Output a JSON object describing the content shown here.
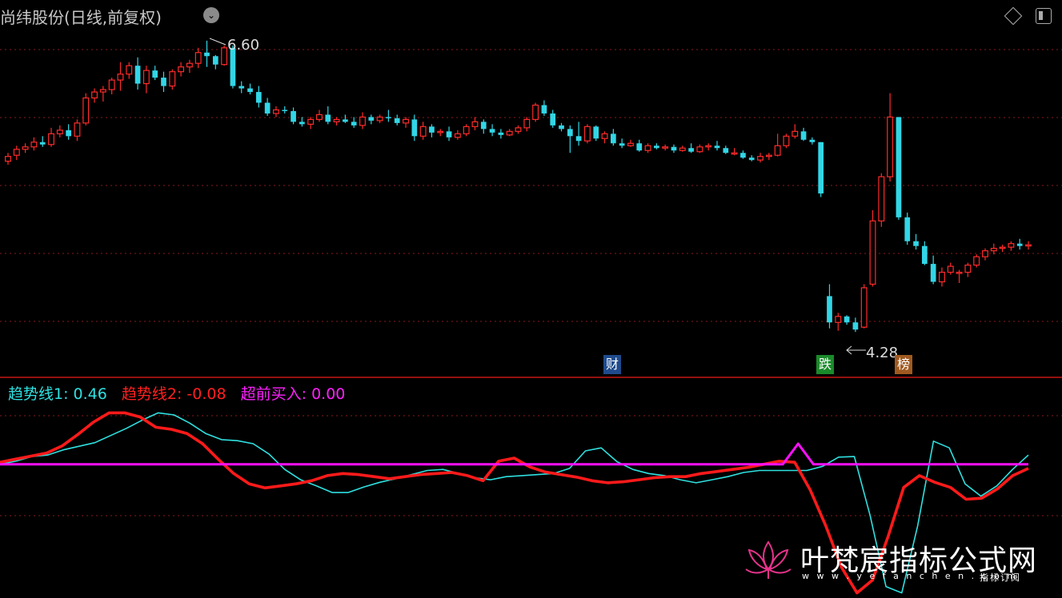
{
  "header": {
    "title": "尚纬股份(日线,前复权)",
    "dropdown_icon": "chevron-down-icon",
    "buttons": [
      "diamond-icon",
      "window-toggle-icon"
    ]
  },
  "colors": {
    "up": "#ff2b2b",
    "down": "#32d6e6",
    "line1": "#2fe0e0",
    "line2": "#ff1a1a",
    "line3": "#ff10ff",
    "grid": "#8a1a1a",
    "separator": "#c81414"
  },
  "annotations": {
    "high_label": "6.60",
    "low_label": "4.28"
  },
  "badges": {
    "cai": "财",
    "die": "跌",
    "bang": "榜"
  },
  "indicator": {
    "line1_label": "趋势线1: 0.46",
    "line2_label": "趋势线2: -0.08",
    "line3_label": "超前买入: 0.00"
  },
  "watermark": {
    "title": "叶梵宸指标公式网",
    "url": "w w w . y e f a n c h e n . c o m",
    "slogan": "指标订阅"
  },
  "chart_data": [
    {
      "type": "candlestick",
      "title": "尚纬股份(日线,前复权)",
      "ylim": [
        4.0,
        7.0
      ],
      "series": [
        {
          "name": "price",
          "candles": [
            [
              5.75,
              5.82,
              5.72,
              5.79
            ],
            [
              5.8,
              5.88,
              5.76,
              5.85
            ],
            [
              5.85,
              5.9,
              5.82,
              5.87
            ],
            [
              5.87,
              5.95,
              5.84,
              5.91
            ],
            [
              5.91,
              5.96,
              5.87,
              5.89
            ],
            [
              5.89,
              6.03,
              5.87,
              5.98
            ],
            [
              5.98,
              6.05,
              5.95,
              6.01
            ],
            [
              6.01,
              6.06,
              5.93,
              5.96
            ],
            [
              5.96,
              6.1,
              5.92,
              6.07
            ],
            [
              6.07,
              6.32,
              6.05,
              6.28
            ],
            [
              6.28,
              6.36,
              6.24,
              6.33
            ],
            [
              6.33,
              6.38,
              6.25,
              6.35
            ],
            [
              6.35,
              6.45,
              6.31,
              6.43
            ],
            [
              6.43,
              6.58,
              6.34,
              6.48
            ],
            [
              6.48,
              6.58,
              6.44,
              6.55
            ],
            [
              6.55,
              6.62,
              6.35,
              6.4
            ],
            [
              6.4,
              6.55,
              6.32,
              6.51
            ],
            [
              6.51,
              6.55,
              6.43,
              6.45
            ],
            [
              6.45,
              6.5,
              6.33,
              6.38
            ],
            [
              6.38,
              6.52,
              6.35,
              6.5
            ],
            [
              6.5,
              6.58,
              6.46,
              6.54
            ],
            [
              6.54,
              6.6,
              6.49,
              6.57
            ],
            [
              6.57,
              6.7,
              6.53,
              6.66
            ],
            [
              6.66,
              6.76,
              6.54,
              6.63
            ],
            [
              6.63,
              6.64,
              6.52,
              6.56
            ],
            [
              6.56,
              6.72,
              6.55,
              6.7
            ],
            [
              6.7,
              6.72,
              6.36,
              6.38
            ],
            [
              6.38,
              6.42,
              6.32,
              6.36
            ],
            [
              6.36,
              6.4,
              6.31,
              6.33
            ],
            [
              6.33,
              6.38,
              6.2,
              6.24
            ],
            [
              6.24,
              6.28,
              6.13,
              6.15
            ],
            [
              6.15,
              6.21,
              6.12,
              6.18
            ],
            [
              6.18,
              6.21,
              6.15,
              6.17
            ],
            [
              6.17,
              6.2,
              6.06,
              6.08
            ],
            [
              6.08,
              6.12,
              6.04,
              6.06
            ],
            [
              6.06,
              6.12,
              6.02,
              6.1
            ],
            [
              6.1,
              6.18,
              6.08,
              6.14
            ],
            [
              6.14,
              6.21,
              6.06,
              6.08
            ],
            [
              6.08,
              6.12,
              6.05,
              6.1
            ],
            [
              6.1,
              6.14,
              6.07,
              6.08
            ],
            [
              6.08,
              6.12,
              6.03,
              6.05
            ],
            [
              6.05,
              6.16,
              6.02,
              6.12
            ],
            [
              6.12,
              6.14,
              6.06,
              6.09
            ],
            [
              6.09,
              6.14,
              6.07,
              6.12
            ],
            [
              6.12,
              6.18,
              6.08,
              6.11
            ],
            [
              6.11,
              6.14,
              6.05,
              6.07
            ],
            [
              6.07,
              6.12,
              6.03,
              6.1
            ],
            [
              6.1,
              6.14,
              5.92,
              5.96
            ],
            [
              5.96,
              6.08,
              5.93,
              6.04
            ],
            [
              6.04,
              6.06,
              5.95,
              5.99
            ],
            [
              5.99,
              6.02,
              5.96,
              6.0
            ],
            [
              6.0,
              6.04,
              5.92,
              5.95
            ],
            [
              5.95,
              6.01,
              5.93,
              5.98
            ],
            [
              5.98,
              6.06,
              5.96,
              6.04
            ],
            [
              6.04,
              6.12,
              6.01,
              6.08
            ],
            [
              6.08,
              6.1,
              5.98,
              6.02
            ],
            [
              6.02,
              6.06,
              5.96,
              5.99
            ],
            [
              5.99,
              6.02,
              5.94,
              5.97
            ],
            [
              5.97,
              6.02,
              5.96,
              6.0
            ],
            [
              6.0,
              6.05,
              5.98,
              6.03
            ],
            [
              6.03,
              6.12,
              6.0,
              6.1
            ],
            [
              6.1,
              6.24,
              6.08,
              6.22
            ],
            [
              6.22,
              6.26,
              6.13,
              6.15
            ],
            [
              6.15,
              6.18,
              6.03,
              6.05
            ],
            [
              6.05,
              6.07,
              6.0,
              6.02
            ],
            [
              6.02,
              6.05,
              5.82,
              5.96
            ],
            [
              5.96,
              6.08,
              5.88,
              5.92
            ],
            [
              5.92,
              6.06,
              5.9,
              6.04
            ],
            [
              6.04,
              6.05,
              5.92,
              5.94
            ],
            [
              5.94,
              6.0,
              5.9,
              5.98
            ],
            [
              5.98,
              6.02,
              5.88,
              5.9
            ],
            [
              5.9,
              5.94,
              5.86,
              5.88
            ],
            [
              5.88,
              5.93,
              5.87,
              5.9
            ],
            [
              5.9,
              5.93,
              5.83,
              5.84
            ],
            [
              5.84,
              5.9,
              5.82,
              5.88
            ],
            [
              5.88,
              5.9,
              5.85,
              5.86
            ],
            [
              5.86,
              5.89,
              5.84,
              5.87
            ],
            [
              5.87,
              5.89,
              5.82,
              5.84
            ],
            [
              5.84,
              5.88,
              5.83,
              5.86
            ],
            [
              5.86,
              5.9,
              5.82,
              5.83
            ],
            [
              5.83,
              5.89,
              5.82,
              5.87
            ],
            [
              5.87,
              5.9,
              5.84,
              5.88
            ],
            [
              5.88,
              5.92,
              5.84,
              5.86
            ],
            [
              5.86,
              5.88,
              5.81,
              5.82
            ],
            [
              5.82,
              5.86,
              5.8,
              5.82
            ],
            [
              5.82,
              5.84,
              5.77,
              5.78
            ],
            [
              5.78,
              5.8,
              5.75,
              5.76
            ],
            [
              5.76,
              5.82,
              5.74,
              5.79
            ],
            [
              5.79,
              5.82,
              5.76,
              5.8
            ],
            [
              5.8,
              5.98,
              5.79,
              5.88
            ],
            [
              5.88,
              5.98,
              5.86,
              5.96
            ],
            [
              5.96,
              6.06,
              5.94,
              6.0
            ],
            [
              6.0,
              6.03,
              5.92,
              5.93
            ],
            [
              5.93,
              5.95,
              5.89,
              5.91
            ],
            [
              5.91,
              5.91,
              5.45,
              5.48
            ],
            [
              4.62,
              4.72,
              4.35,
              4.4
            ],
            [
              4.4,
              4.48,
              4.33,
              4.45
            ],
            [
              4.45,
              4.46,
              4.38,
              4.4
            ],
            [
              4.4,
              4.44,
              4.32,
              4.34
            ],
            [
              4.36,
              4.72,
              4.35,
              4.69
            ],
            [
              4.72,
              5.34,
              4.7,
              5.25
            ],
            [
              5.25,
              5.65,
              5.2,
              5.62
            ],
            [
              5.62,
              6.32,
              5.58,
              6.12
            ],
            [
              6.12,
              6.12,
              5.26,
              5.28
            ],
            [
              5.28,
              5.32,
              5.05,
              5.08
            ],
            [
              5.08,
              5.14,
              5.01,
              5.04
            ],
            [
              5.04,
              5.08,
              4.88,
              4.89
            ],
            [
              4.89,
              4.96,
              4.72,
              4.74
            ],
            [
              4.74,
              4.86,
              4.7,
              4.82
            ],
            [
              4.82,
              4.9,
              4.8,
              4.87
            ],
            [
              4.82,
              4.84,
              4.73,
              4.82
            ],
            [
              4.82,
              4.9,
              4.78,
              4.88
            ],
            [
              4.88,
              4.97,
              4.86,
              4.95
            ],
            [
              4.95,
              5.02,
              4.92,
              5.0
            ],
            [
              5.0,
              5.06,
              4.97,
              5.02
            ],
            [
              5.02,
              5.05,
              4.99,
              5.03
            ],
            [
              5.03,
              5.08,
              5.0,
              5.06
            ],
            [
              5.06,
              5.1,
              5.01,
              5.04
            ],
            [
              5.04,
              5.08,
              5.01,
              5.05
            ]
          ]
        }
      ]
    },
    {
      "type": "line",
      "ylim": [
        -2.6,
        1.1
      ],
      "series": [
        {
          "name": "趋势线1",
          "values": [
            0.0,
            0.06,
            0.15,
            0.18,
            0.28,
            0.35,
            0.42,
            0.56,
            0.7,
            0.86,
            1.0,
            0.96,
            0.8,
            0.6,
            0.48,
            0.46,
            0.4,
            0.2,
            -0.1,
            -0.3,
            -0.42,
            -0.55,
            -0.55,
            -0.44,
            -0.35,
            -0.28,
            -0.2,
            -0.12,
            -0.1,
            -0.18,
            -0.26,
            -0.3,
            -0.24,
            -0.22,
            -0.2,
            -0.18,
            -0.08,
            0.26,
            0.32,
            0.05,
            -0.1,
            -0.18,
            -0.22,
            -0.3,
            -0.36,
            -0.3,
            -0.24,
            -0.16,
            -0.12,
            -0.12,
            -0.12,
            -0.12,
            -0.04,
            0.14,
            0.15,
            -1.0,
            -2.38,
            -2.5,
            -1.2,
            0.45,
            0.32,
            -0.38,
            -0.62,
            -0.42,
            -0.1,
            0.18
          ]
        },
        {
          "name": "趋势线2",
          "values": [
            0.04,
            0.1,
            0.16,
            0.22,
            0.36,
            0.58,
            0.82,
            1.0,
            1.0,
            0.92,
            0.72,
            0.68,
            0.6,
            0.4,
            0.1,
            -0.18,
            -0.38,
            -0.46,
            -0.42,
            -0.38,
            -0.32,
            -0.22,
            -0.18,
            -0.2,
            -0.24,
            -0.28,
            -0.24,
            -0.2,
            -0.18,
            -0.16,
            -0.22,
            -0.32,
            0.06,
            0.12,
            -0.05,
            -0.15,
            -0.2,
            -0.25,
            -0.32,
            -0.36,
            -0.34,
            -0.3,
            -0.26,
            -0.24,
            -0.24,
            -0.18,
            -0.14,
            -0.1,
            -0.06,
            0.0,
            0.06,
            0.04,
            -0.5,
            -1.2,
            -2.0,
            -2.5,
            -2.25,
            -1.4,
            -0.45,
            -0.22,
            -0.35,
            -0.45,
            -0.68,
            -0.66,
            -0.48,
            -0.22,
            -0.08
          ]
        },
        {
          "name": "超前买入",
          "values": [
            0,
            0,
            0,
            0,
            0,
            0,
            0,
            0,
            0,
            0,
            0,
            0,
            0,
            0,
            0,
            0,
            0,
            0,
            0,
            0,
            0,
            0,
            0,
            0,
            0,
            0,
            0,
            0,
            0,
            0,
            0,
            0,
            0,
            0,
            0,
            0,
            0,
            0,
            0,
            0,
            0,
            0,
            0,
            0,
            0,
            0,
            0,
            0,
            0,
            0,
            0,
            0,
            0.4,
            0,
            0,
            0,
            0,
            0,
            0,
            0,
            0,
            0,
            0,
            0,
            0,
            0,
            0,
            0
          ]
        }
      ]
    }
  ]
}
